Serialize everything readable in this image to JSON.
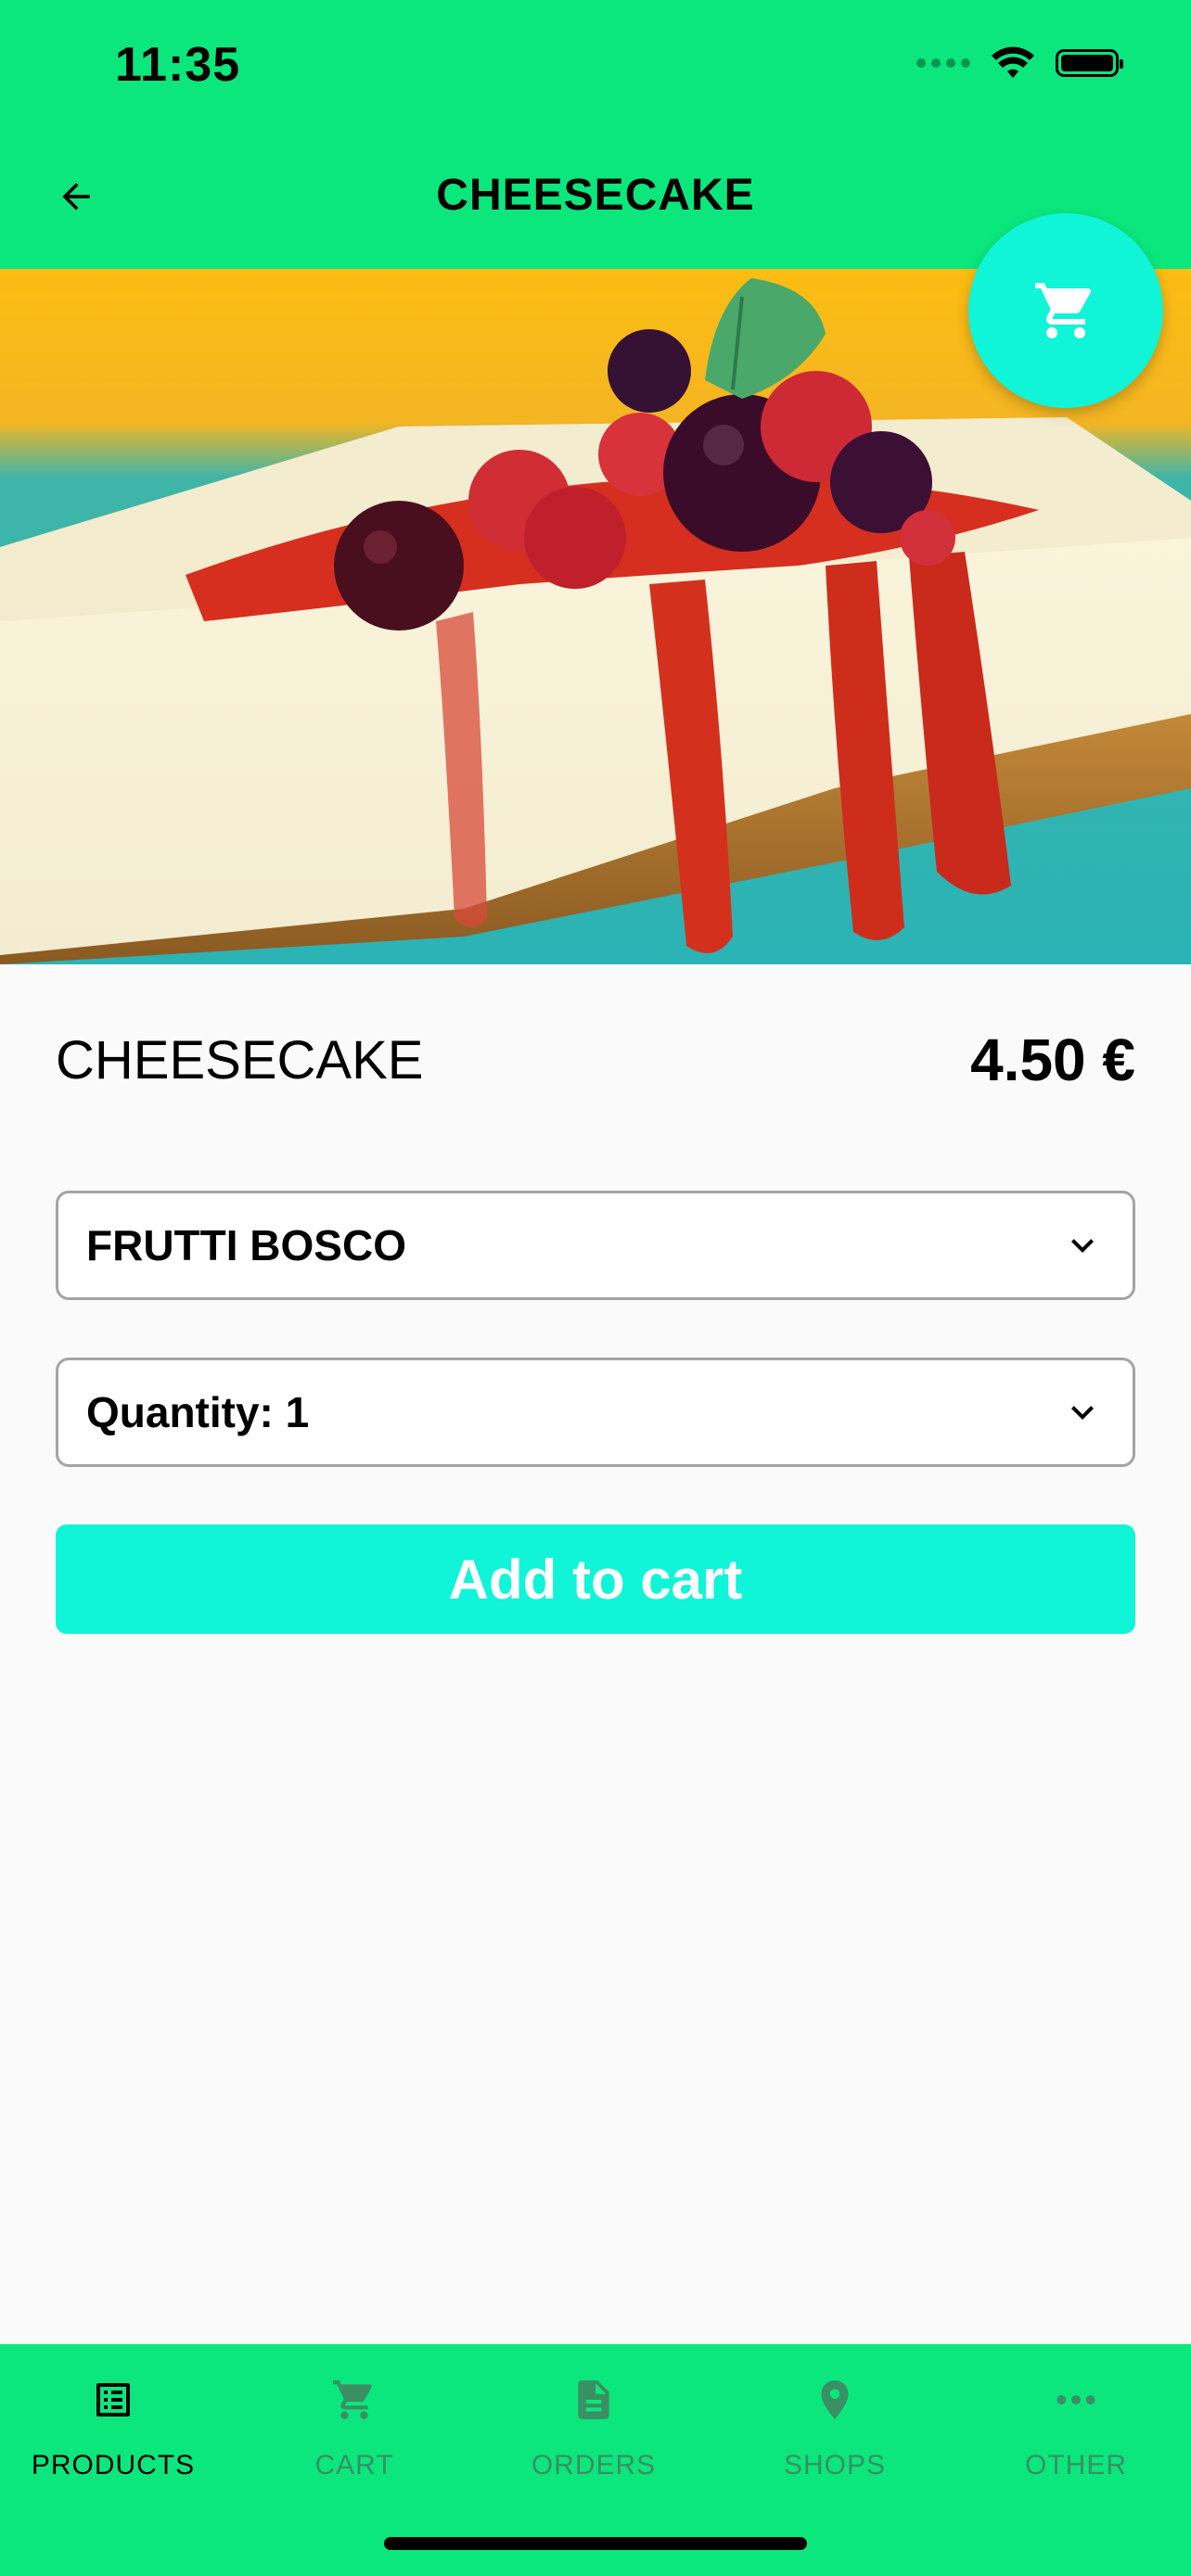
{
  "status_bar": {
    "time": "11:35"
  },
  "header": {
    "title": "CHEESECAKE"
  },
  "product": {
    "name": "CHEESECAKE",
    "price": "4.50 €"
  },
  "options": {
    "flavor_selected": "FRUTTI BOSCO",
    "quantity_selected": "Quantity: 1"
  },
  "actions": {
    "add_to_cart_label": "Add to cart"
  },
  "bottom_nav": {
    "items": [
      {
        "label": "PRODUCTS",
        "icon": "list-icon",
        "active": true
      },
      {
        "label": "CART",
        "icon": "cart-icon",
        "active": false
      },
      {
        "label": "ORDERS",
        "icon": "document-icon",
        "active": false
      },
      {
        "label": "SHOPS",
        "icon": "location-pin-icon",
        "active": false
      },
      {
        "label": "OTHER",
        "icon": "more-horizontal-icon",
        "active": false
      }
    ]
  },
  "colors": {
    "brand_green": "#0be77d",
    "accent_cyan": "#10f4d8",
    "inactive_nav": "#3a8f63",
    "background": "#fafafa"
  }
}
